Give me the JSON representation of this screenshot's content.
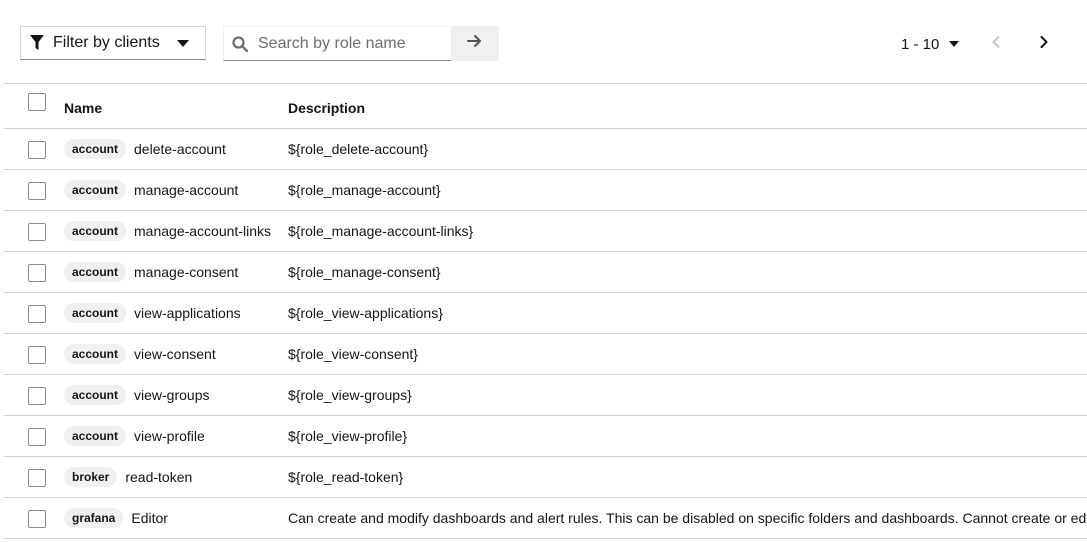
{
  "toolbar": {
    "filter_label": "Filter by clients",
    "search_placeholder": "Search by role name",
    "search_value": ""
  },
  "pagination": {
    "range": "1 - 10"
  },
  "table": {
    "columns": {
      "name": "Name",
      "description": "Description"
    },
    "rows": [
      {
        "client": "account",
        "role": "delete-account",
        "description": "${role_delete-account}"
      },
      {
        "client": "account",
        "role": "manage-account",
        "description": "${role_manage-account}"
      },
      {
        "client": "account",
        "role": "manage-account-links",
        "description": "${role_manage-account-links}"
      },
      {
        "client": "account",
        "role": "manage-consent",
        "description": "${role_manage-consent}"
      },
      {
        "client": "account",
        "role": "view-applications",
        "description": "${role_view-applications}"
      },
      {
        "client": "account",
        "role": "view-consent",
        "description": "${role_view-consent}"
      },
      {
        "client": "account",
        "role": "view-groups",
        "description": "${role_view-groups}"
      },
      {
        "client": "account",
        "role": "view-profile",
        "description": "${role_view-profile}"
      },
      {
        "client": "broker",
        "role": "read-token",
        "description": "${role_read-token}"
      },
      {
        "client": "grafana",
        "role": "Editor",
        "description": "Can create and modify dashboards and alert rules. This can be disabled on specific folders and dashboards. Cannot create or edit"
      }
    ]
  },
  "colors": {
    "border": "#d2d2d2",
    "chip_bg": "#f0f0f0",
    "text": "#151515",
    "muted": "#6a6e73"
  },
  "icons": {
    "filter": "filter-icon",
    "search": "search-icon",
    "go": "arrow-right-icon",
    "prev": "angle-left-icon",
    "next": "angle-right-icon"
  }
}
